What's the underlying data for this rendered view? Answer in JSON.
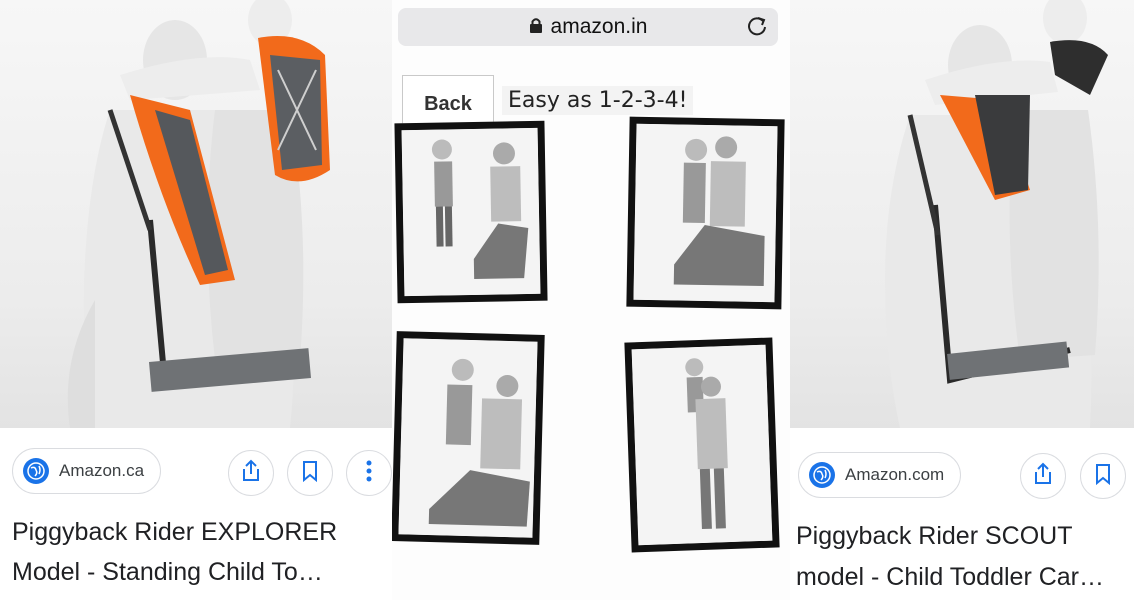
{
  "left_card": {
    "source": "Amazon.ca",
    "title_line1": "Piggyback Rider EXPLORER",
    "title_line2": "Model - Standing Child To…"
  },
  "middle": {
    "url": "amazon.in",
    "back_label": "Back",
    "banner_text": "Easy as 1-2-3-4!"
  },
  "right_card": {
    "source": "Amazon.com",
    "title_line1": "Piggyback Rider SCOUT",
    "title_line2": "model - Child Toddler Car…"
  },
  "colors": {
    "accent": "#1a73e8",
    "carrier_orange": "#f26a1b",
    "carrier_gray": "#55585c"
  },
  "icons": [
    "globe-icon",
    "share-icon",
    "bookmark-icon",
    "more-vert-icon",
    "lock-icon",
    "reload-icon"
  ]
}
